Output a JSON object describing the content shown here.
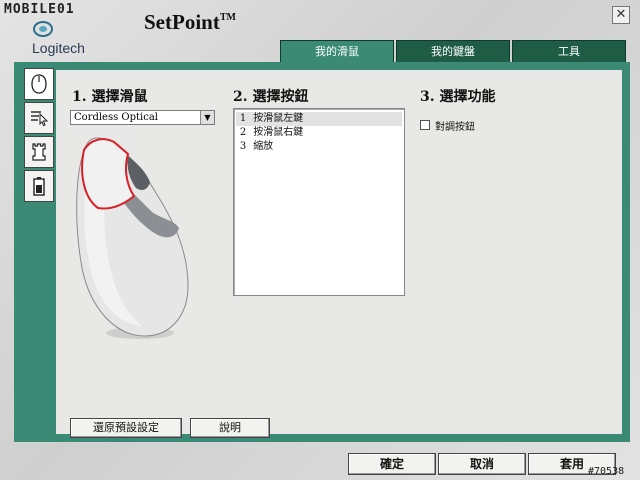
{
  "watermark": {
    "text": "MOBILE01"
  },
  "brand": {
    "logo_icon": "logitech-logo-icon",
    "name": "Logitech"
  },
  "app": {
    "title": "SetPoint",
    "trademark": "TM",
    "close_icon": "close-icon",
    "close_glyph": "✕"
  },
  "tabs": [
    {
      "label": "我的滑鼠",
      "active": true
    },
    {
      "label": "我的鍵盤",
      "active": false
    },
    {
      "label": "工具",
      "active": false
    }
  ],
  "side_tabs": [
    {
      "icon": "mouse-icon"
    },
    {
      "icon": "pointer-settings-icon"
    },
    {
      "icon": "chess-rook-icon"
    },
    {
      "icon": "battery-icon"
    }
  ],
  "section1": {
    "number": "1.",
    "title": "選擇滑鼠",
    "selected_mouse": "Cordless Optical",
    "dropdown_icon": "chevron-down-icon",
    "dropdown_glyph": "▼"
  },
  "section2": {
    "number": "2.",
    "title": "選擇按鈕",
    "buttons": [
      {
        "num": "1",
        "label": "按滑鼠左鍵",
        "selected": true
      },
      {
        "num": "2",
        "label": "按滑鼠右鍵",
        "selected": false
      },
      {
        "num": "3",
        "label": "縮放",
        "selected": false
      }
    ]
  },
  "section3": {
    "number": "3.",
    "title": "選擇功能",
    "checkbox_label": "對調按鈕",
    "checked": false
  },
  "footer": {
    "restore_defaults": "還原預設設定",
    "help": "說明",
    "ok": "確定",
    "cancel": "取消",
    "apply": "套用"
  },
  "credit": "#70538",
  "colors": {
    "tab_dark": "#1e5c46",
    "panel_teal": "#3b8a76",
    "highlight_red": "#d6202a"
  }
}
